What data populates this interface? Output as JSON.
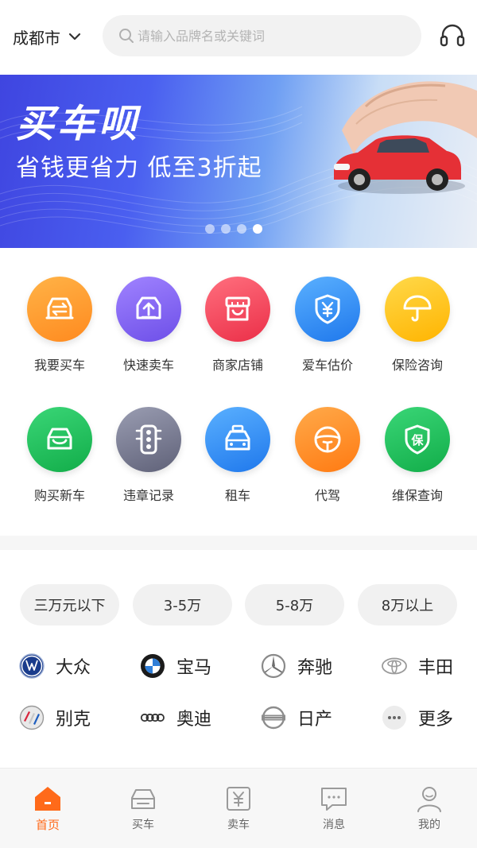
{
  "header": {
    "city": "成都市",
    "search_placeholder": "请输入品牌名或关键词"
  },
  "banner": {
    "title": "买车呗",
    "subtitle": "省钱更省力 低至3折起",
    "slide_count": 4,
    "active_slide": 4
  },
  "services": [
    {
      "label": "我要买车",
      "icon": "car-exchange-icon",
      "color": "#ff9a2e"
    },
    {
      "label": "快速卖车",
      "icon": "car-upload-icon",
      "color": "#8a66f2"
    },
    {
      "label": "商家店铺",
      "icon": "store-icon",
      "color": "#f4455b"
    },
    {
      "label": "爱车估价",
      "icon": "yuan-shield-icon",
      "color": "#2f8ff5"
    },
    {
      "label": "保险咨询",
      "icon": "umbrella-icon",
      "color": "#ffc20e"
    },
    {
      "label": "购买新车",
      "icon": "new-car-icon",
      "color": "#22c25e"
    },
    {
      "label": "违章记录",
      "icon": "traffic-light-icon",
      "color": "#7d8096"
    },
    {
      "label": "租车",
      "icon": "taxi-icon",
      "color": "#2f8ff5"
    },
    {
      "label": "代驾",
      "icon": "steering-wheel-icon",
      "color": "#ff8a2a"
    },
    {
      "label": "维保查询",
      "icon": "warranty-shield-icon",
      "color": "#22c25e"
    }
  ],
  "price_ranges": [
    "三万元以下",
    "3-5万",
    "5-8万",
    "8万以上"
  ],
  "brands": [
    {
      "name": "大众",
      "icon": "volkswagen-logo-icon"
    },
    {
      "name": "宝马",
      "icon": "bmw-logo-icon"
    },
    {
      "name": "奔驰",
      "icon": "mercedes-logo-icon"
    },
    {
      "name": "丰田",
      "icon": "toyota-logo-icon"
    },
    {
      "name": "别克",
      "icon": "buick-logo-icon"
    },
    {
      "name": "奥迪",
      "icon": "audi-logo-icon"
    },
    {
      "name": "日产",
      "icon": "nissan-logo-icon"
    },
    {
      "name": "更多",
      "icon": "more-dots-icon"
    }
  ],
  "tabs": [
    {
      "label": "首页",
      "icon": "home-icon",
      "active": true
    },
    {
      "label": "买车",
      "icon": "car-icon",
      "active": false
    },
    {
      "label": "卖车",
      "icon": "sell-yuan-icon",
      "active": false
    },
    {
      "label": "消息",
      "icon": "message-icon",
      "active": false
    },
    {
      "label": "我的",
      "icon": "profile-icon",
      "active": false
    }
  ],
  "colors": {
    "accent": "#ff6a1a",
    "banner_start": "#3f45e0",
    "banner_end": "#e9eef6"
  }
}
